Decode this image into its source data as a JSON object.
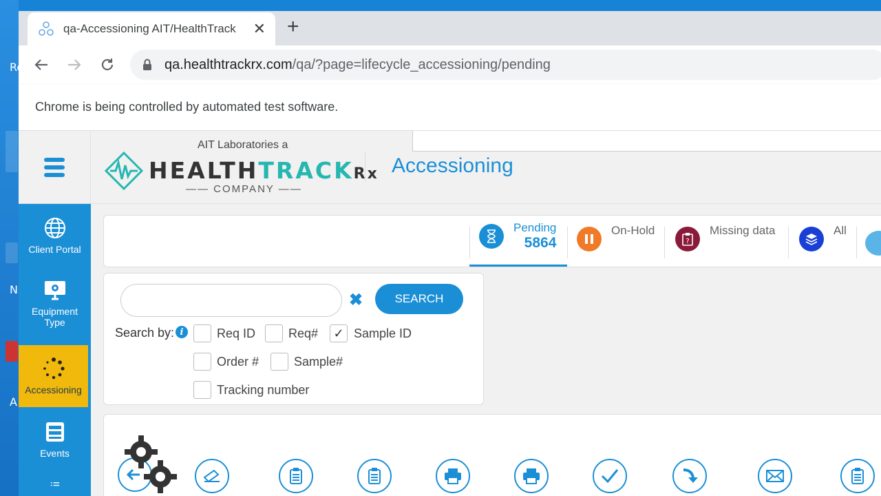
{
  "desktop": {
    "partial_texts": [
      "Re",
      "N",
      "A"
    ]
  },
  "browser": {
    "tab": {
      "title": "qa-Accessioning AIT/HealthTrack",
      "close": "✕"
    },
    "new_tab": "+",
    "url": {
      "host": "qa.healthtrackrx.com",
      "path": "/qa/?page=lifecycle_accessioning/pending"
    },
    "infobar": "Chrome is being controlled by automated test software."
  },
  "app": {
    "logo": {
      "top": "AIT Laboratories a",
      "main_1": "HEALTH",
      "main_2": "TRACK",
      "rx": "Rx",
      "bottom": "COMPANY"
    },
    "page_title": "Accessioning",
    "sidebar": [
      {
        "label": "Client Portal",
        "icon": "globe-icon"
      },
      {
        "label": "Equipment Type",
        "icon": "monitor-gear-icon"
      },
      {
        "label": "Accessioning",
        "icon": "spinner-icon",
        "active": true
      },
      {
        "label": "Events",
        "icon": "server-icon"
      }
    ],
    "status_tabs": [
      {
        "label": "Pending",
        "count": "5864",
        "color": "#1b8fd6",
        "icon": "hourglass-icon"
      },
      {
        "label": "On-Hold",
        "color": "#f07a28",
        "icon": "pause-icon"
      },
      {
        "label": "Missing data",
        "color": "#8b1a3a",
        "icon": "clipboard-question-icon"
      },
      {
        "label": "All",
        "color": "#1a3fd6",
        "icon": "layers-icon"
      }
    ],
    "search": {
      "input_value": "",
      "button": "SEARCH",
      "search_by": "Search by:",
      "info": "i",
      "options": [
        {
          "label": "Req ID",
          "checked": false
        },
        {
          "label": "Req#",
          "checked": false
        },
        {
          "label": "Sample ID",
          "checked": true
        },
        {
          "label": "Order #",
          "checked": false
        },
        {
          "label": "Sample#",
          "checked": false
        },
        {
          "label": "Tracking number",
          "checked": false
        }
      ]
    },
    "colors": {
      "accent": "#1b8fd6",
      "active_nav": "#f0b90b"
    }
  }
}
